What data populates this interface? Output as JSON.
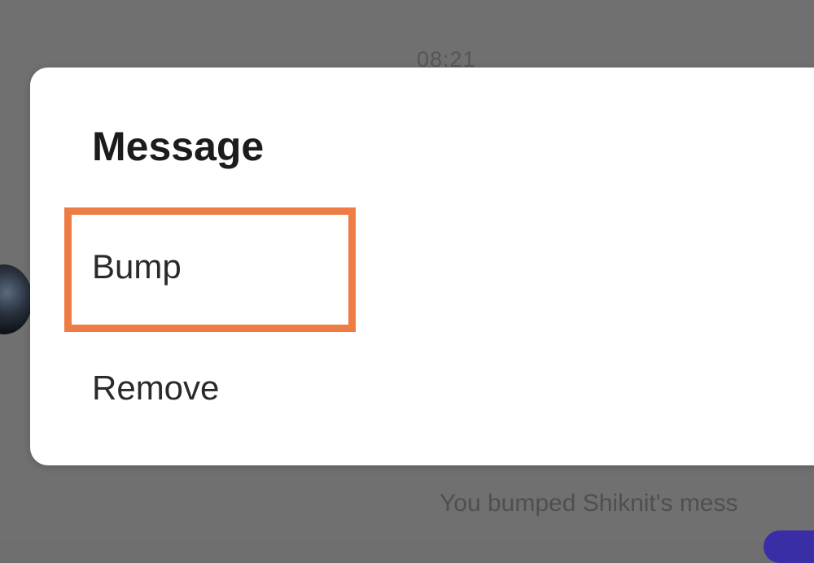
{
  "background": {
    "timestamp": "08:21",
    "system_note": "You bumped Shiknit's mess"
  },
  "dialog": {
    "title": "Message",
    "items": [
      {
        "label": "Bump",
        "highlighted": true
      },
      {
        "label": "Remove",
        "highlighted": false
      }
    ]
  },
  "colors": {
    "overlay": "#707070",
    "dialog_bg": "#ffffff",
    "highlight": "#ee7d45",
    "send_button": "#3a2ea6"
  }
}
